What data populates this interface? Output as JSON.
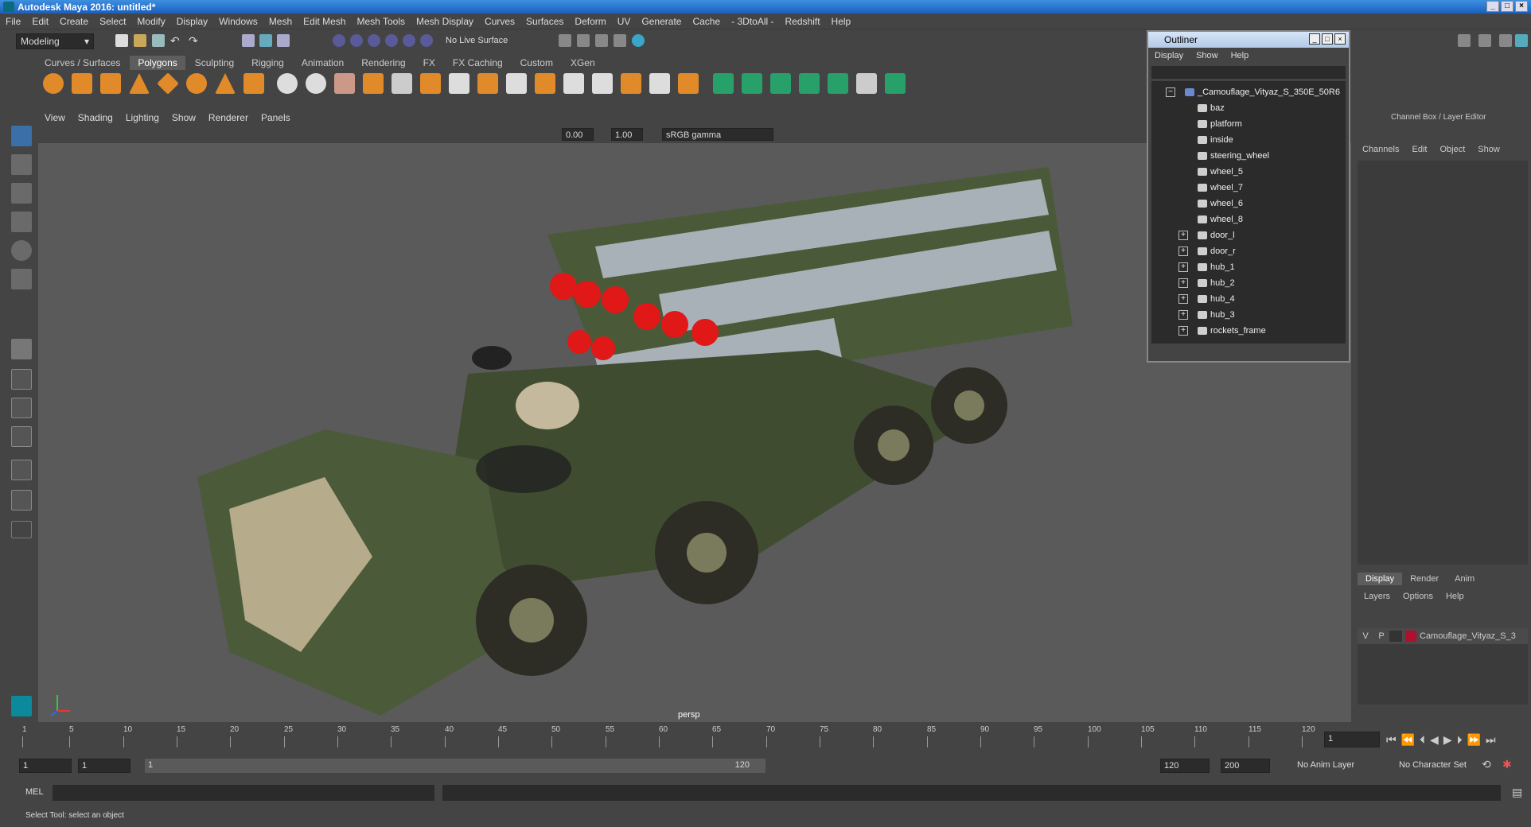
{
  "window": {
    "title": "Autodesk Maya 2016: untitled*",
    "controls": [
      "_",
      "□",
      "×"
    ]
  },
  "menubar": [
    "File",
    "Edit",
    "Create",
    "Select",
    "Modify",
    "Display",
    "Windows",
    "Mesh",
    "Edit Mesh",
    "Mesh Tools",
    "Mesh Display",
    "Curves",
    "Surfaces",
    "Deform",
    "UV",
    "Generate",
    "Cache",
    "- 3DtoAll -",
    "Redshift",
    "Help"
  ],
  "statusline": {
    "mode": "Modeling",
    "live_surface": "No Live Surface"
  },
  "shelf": {
    "tabs": [
      "Curves / Surfaces",
      "Polygons",
      "Sculpting",
      "Rigging",
      "Animation",
      "Rendering",
      "FX",
      "FX Caching",
      "Custom",
      "XGen"
    ],
    "active": "Polygons"
  },
  "viewport": {
    "menu": [
      "View",
      "Shading",
      "Lighting",
      "Show",
      "Renderer",
      "Panels"
    ],
    "exposure": "0.00",
    "gamma": "1.00",
    "color_space": "sRGB gamma",
    "camera_label": "persp"
  },
  "outliner": {
    "title": "Outliner",
    "menu": [
      "Display",
      "Show",
      "Help"
    ],
    "items": [
      {
        "label": "_Camouflage_Vityaz_S_350E_50R6",
        "expand": "−",
        "root": true
      },
      {
        "label": "baz",
        "expand": ""
      },
      {
        "label": "platform",
        "expand": ""
      },
      {
        "label": "inside",
        "expand": ""
      },
      {
        "label": "steering_wheel",
        "expand": ""
      },
      {
        "label": "wheel_5",
        "expand": ""
      },
      {
        "label": "wheel_7",
        "expand": ""
      },
      {
        "label": "wheel_6",
        "expand": ""
      },
      {
        "label": "wheel_8",
        "expand": ""
      },
      {
        "label": "door_l",
        "expand": "+"
      },
      {
        "label": "door_r",
        "expand": "+"
      },
      {
        "label": "hub_1",
        "expand": "+"
      },
      {
        "label": "hub_2",
        "expand": "+"
      },
      {
        "label": "hub_4",
        "expand": "+"
      },
      {
        "label": "hub_3",
        "expand": "+"
      },
      {
        "label": "rockets_frame",
        "expand": "+"
      }
    ]
  },
  "channelbox": {
    "title": "Channel Box / Layer Editor",
    "menu": [
      "Channels",
      "Edit",
      "Object",
      "Show"
    ],
    "layer_tabs": [
      "Display",
      "Render",
      "Anim"
    ],
    "layer_active": "Display",
    "layer_menu": [
      "Layers",
      "Options",
      "Help"
    ],
    "layer": {
      "v": "V",
      "p": "P",
      "name": "Camouflage_Vityaz_S_3",
      "color": "#b01030"
    }
  },
  "timeline": {
    "ticks": [
      "1",
      "5",
      "10",
      "15",
      "20",
      "25",
      "30",
      "35",
      "40",
      "45",
      "50",
      "55",
      "60",
      "65",
      "70",
      "75",
      "80",
      "85",
      "90",
      "95",
      "100",
      "105",
      "110",
      "115",
      "120"
    ],
    "current_frame": "1"
  },
  "range": {
    "start": "1",
    "start2": "1",
    "slider_start": "1",
    "slider_end": "120",
    "end": "120",
    "end2": "200",
    "anim_layer": "No Anim Layer",
    "char_set": "No Character Set"
  },
  "cmdline": {
    "label": "MEL"
  },
  "helpline": {
    "text": "Select Tool: select an object"
  }
}
